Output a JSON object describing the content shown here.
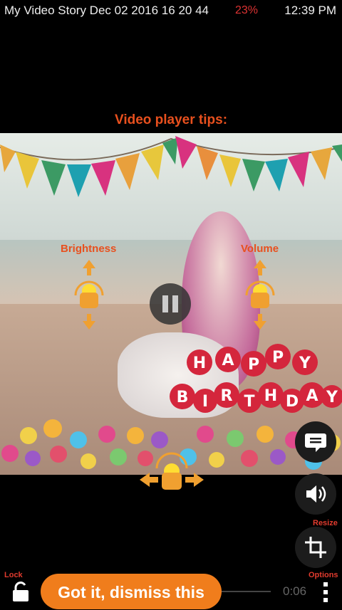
{
  "status_bar": {
    "title": "My Video Story Dec 02 2016 16 20 44",
    "battery": "23%",
    "time": "12:39 PM"
  },
  "tips": {
    "title": "Video player tips:",
    "brightness_label": "Brightness",
    "volume_label": "Volume"
  },
  "side_controls": {
    "resize_label": "Resize",
    "options_label": "Options",
    "lock_label": "Lock"
  },
  "bottom": {
    "dismiss_label": "Got it, dismiss this",
    "current_time": "0:06"
  },
  "balloon_text": [
    "H",
    "A",
    "P",
    "P",
    "Y",
    "B",
    "I",
    "R",
    "T",
    "H",
    "D",
    "A",
    "Y"
  ],
  "colors": {
    "accent_orange": "#f07d1c",
    "tip_orange": "#e8501e",
    "side_red": "#e23b2e"
  }
}
